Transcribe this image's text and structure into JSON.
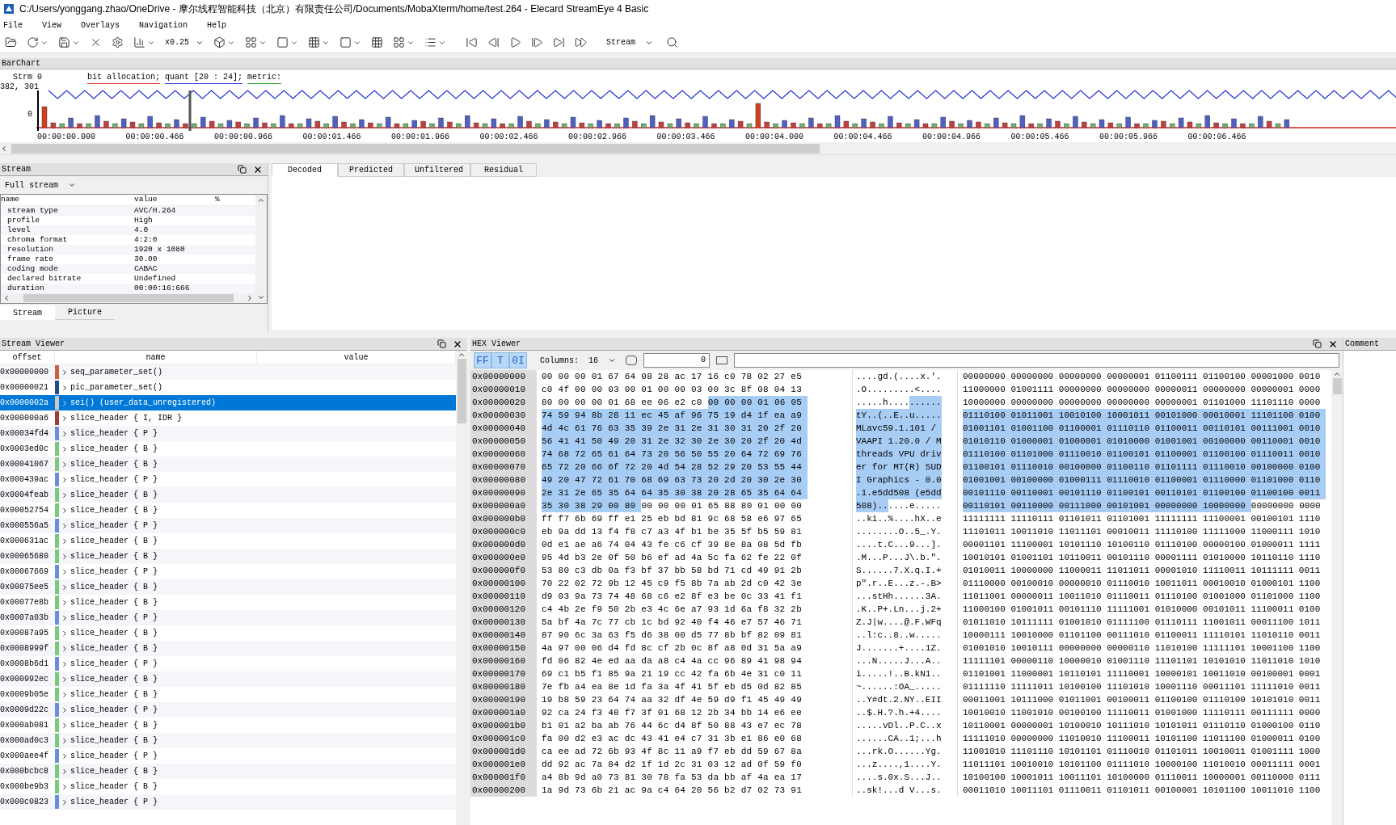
{
  "window": {
    "title": "C:/Users/yonggang.zhao/OneDrive - 摩尔线程智能科技（北京）有限责任公司/Documents/MobaXterm/home/test.264 - Elecard StreamEye 4 Basic"
  },
  "menu": [
    "File",
    "View",
    "Overlays",
    "Navigation",
    "Help"
  ],
  "toolbar": {
    "zoom": "x0.25",
    "stream": "Stream"
  },
  "barchart": {
    "title": "BarChart",
    "legend": [
      {
        "text": "bit allocation;",
        "color": "#e02020"
      },
      {
        "text": "quant [20 : 24];",
        "color": "#2040e0"
      },
      {
        "text": "metric:",
        "color": "#20a020"
      }
    ],
    "stream_label": "Strm 0",
    "y_max": "382, 301",
    "y_min": "0",
    "times": [
      "00:00:00.000",
      "00:00:00.466",
      "00:00:00.966",
      "00:00:01.466",
      "00:00:01.966",
      "00:00:02.466",
      "00:00:02.966",
      "00:00:03.466",
      "00:00:04.000",
      "00:00:04.466",
      "00:00:04.966",
      "00:00:05.466",
      "00:00:05.966",
      "00:00:06.466"
    ]
  },
  "stream_panel": {
    "title": "Stream",
    "filter": "Full stream",
    "columns": [
      "name",
      "value",
      "%"
    ],
    "rows": [
      {
        "name": "stream type",
        "value": "AVC/H.264"
      },
      {
        "name": "profile",
        "value": "High"
      },
      {
        "name": "level",
        "value": "4.0"
      },
      {
        "name": "chroma format",
        "value": "4:2:0"
      },
      {
        "name": "resolution",
        "value": "1920 x 1080"
      },
      {
        "name": "frame rate",
        "value": "30.00"
      },
      {
        "name": "coding mode",
        "value": "CABAC"
      },
      {
        "name": "declared bitrate",
        "value": "Undefined"
      },
      {
        "name": "duration",
        "value": "00:00:16:666"
      }
    ],
    "tabs": [
      {
        "label": "Stream",
        "selected": true
      },
      {
        "label": "Picture",
        "selected": false
      }
    ]
  },
  "picture_tabs": [
    {
      "label": "Decoded",
      "selected": true
    },
    {
      "label": "Predicted",
      "selected": false
    },
    {
      "label": "Unfiltered",
      "selected": false
    },
    {
      "label": "Residual",
      "selected": false
    }
  ],
  "stream_viewer": {
    "title": "Stream Viewer",
    "columns": [
      "offset",
      "name",
      "value"
    ],
    "rows": [
      {
        "offset": "0x00000000",
        "name": "seq_parameter_set()",
        "color": "#c8643c",
        "selected": false
      },
      {
        "offset": "0x00000021",
        "name": "pic_parameter_set()",
        "color": "#1f4e8c",
        "selected": false
      },
      {
        "offset": "0x0000002a",
        "name": "sei() (user_data_unregistered)",
        "color": "#c8c8c8",
        "selected": true
      },
      {
        "offset": "0x000000a6",
        "name": "slice_header { I, IDR }",
        "color": "#a03c32",
        "selected": false
      },
      {
        "offset": "0x00034fd4",
        "name": "slice_header { P }",
        "color": "#6b8ce0",
        "selected": false
      },
      {
        "offset": "0x0003ed0c",
        "name": "slice_header { B }",
        "color": "#7cc87c",
        "selected": false
      },
      {
        "offset": "0x00041067",
        "name": "slice_header { B }",
        "color": "#7cc87c",
        "selected": false
      },
      {
        "offset": "0x000439ac",
        "name": "slice_header { P }",
        "color": "#6b8ce0",
        "selected": false
      },
      {
        "offset": "0x0004feab",
        "name": "slice_header { B }",
        "color": "#7cc87c",
        "selected": false
      },
      {
        "offset": "0x00052754",
        "name": "slice_header { B }",
        "color": "#7cc87c",
        "selected": false
      },
      {
        "offset": "0x000556a5",
        "name": "slice_header { P }",
        "color": "#6b8ce0",
        "selected": false
      },
      {
        "offset": "0x000631ac",
        "name": "slice_header { B }",
        "color": "#7cc87c",
        "selected": false
      },
      {
        "offset": "0x00065680",
        "name": "slice_header { B }",
        "color": "#7cc87c",
        "selected": false
      },
      {
        "offset": "0x00067669",
        "name": "slice_header { P }",
        "color": "#6b8ce0",
        "selected": false
      },
      {
        "offset": "0x00075ee5",
        "name": "slice_header { B }",
        "color": "#7cc87c",
        "selected": false
      },
      {
        "offset": "0x00077e8b",
        "name": "slice_header { B }",
        "color": "#7cc87c",
        "selected": false
      },
      {
        "offset": "0x0007a03b",
        "name": "slice_header { P }",
        "color": "#6b8ce0",
        "selected": false
      },
      {
        "offset": "0x00087a95",
        "name": "slice_header { B }",
        "color": "#7cc87c",
        "selected": false
      },
      {
        "offset": "0x0008999f",
        "name": "slice_header { B }",
        "color": "#7cc87c",
        "selected": false
      },
      {
        "offset": "0x0008b6d1",
        "name": "slice_header { P }",
        "color": "#6b8ce0",
        "selected": false
      },
      {
        "offset": "0x000992ec",
        "name": "slice_header { B }",
        "color": "#7cc87c",
        "selected": false
      },
      {
        "offset": "0x0009b05e",
        "name": "slice_header { B }",
        "color": "#7cc87c",
        "selected": false
      },
      {
        "offset": "0x0009d22c",
        "name": "slice_header { P }",
        "color": "#6b8ce0",
        "selected": false
      },
      {
        "offset": "0x000ab081",
        "name": "slice_header { B }",
        "color": "#7cc87c",
        "selected": false
      },
      {
        "offset": "0x000ad0c3",
        "name": "slice_header { B }",
        "color": "#7cc87c",
        "selected": false
      },
      {
        "offset": "0x000aee4f",
        "name": "slice_header { P }",
        "color": "#6b8ce0",
        "selected": false
      },
      {
        "offset": "0x000bcbc8",
        "name": "slice_header { B }",
        "color": "#7cc87c",
        "selected": false
      },
      {
        "offset": "0x000be9b3",
        "name": "slice_header { B }",
        "color": "#7cc87c",
        "selected": false
      },
      {
        "offset": "0x000c0823",
        "name": "slice_header { P }",
        "color": "#6b8ce0",
        "selected": false
      }
    ]
  },
  "hex_viewer": {
    "title": "HEX Viewer",
    "modes": [
      {
        "label": "FF",
        "selected": true
      },
      {
        "label": "T",
        "selected": true
      },
      {
        "label": "0I",
        "selected": true
      }
    ],
    "columns_label": "Columns:",
    "columns_value": "16",
    "offset_value": "0",
    "rows": [
      {
        "offset": "0x00000000",
        "hex": [
          {
            "text": "00 00 00 01 67 64 08 28 ac 17 16 c0 78 02 27 e5",
            "selected": false
          }
        ],
        "ascii": [
          {
            "text": "....gd.(....x.'.",
            "selected": false
          }
        ],
        "bits": [
          {
            "text": "00000000 00000000 00000000 00000001 01100111 01100100 00001000 0010",
            "selected": false
          }
        ]
      },
      {
        "offset": "0x00000010",
        "hex": [
          {
            "text": "c0 4f 00 00 03 00 01 00 00 03 00 3c 8f 08 04 13",
            "selected": false
          }
        ],
        "ascii": [
          {
            "text": ".O.........<....",
            "selected": false
          }
        ],
        "bits": [
          {
            "text": "11000000 01001111 00000000 00000000 00000011 00000000 00000001 0000",
            "selected": false
          }
        ]
      },
      {
        "offset": "0x00000020",
        "hex": [
          {
            "text": "80 00 00 00 01 68 ee 06 e2 c0",
            "selected": false
          },
          {
            "text": "00 00 00 01 06 05",
            "selected": true
          }
        ],
        "ascii": [
          {
            "text": ".....h....",
            "selected": false
          },
          {
            "text": "......",
            "selected": true
          }
        ],
        "bits": [
          {
            "text": "10000000 00000000 00000000 00000000 00000001 01101000 11101110 0000",
            "selected": false
          }
        ]
      },
      {
        "offset": "0x00000030",
        "hex": [
          {
            "text": "74 59 94 8b 28 11 ec 45 af 96 75 19 d4 1f ea a9",
            "selected": true
          }
        ],
        "ascii": [
          {
            "text": "tY..(..E..u.....",
            "selected": true
          }
        ],
        "bits": [
          {
            "text": "01110100 01011001 10010100 10001011 00101000 00010001 11101100 0100",
            "selected": true
          }
        ]
      },
      {
        "offset": "0x00000040",
        "hex": [
          {
            "text": "4d 4c 61 76 63 35 39 2e 31 2e 31 30 31 20 2f 20",
            "selected": true
          }
        ],
        "ascii": [
          {
            "text": "MLavc59.1.101 / ",
            "selected": true
          }
        ],
        "bits": [
          {
            "text": "01001101 01001100 01100001 01110110 01100011 00110101 00111001 0010",
            "selected": true
          }
        ]
      },
      {
        "offset": "0x00000050",
        "hex": [
          {
            "text": "56 41 41 50 49 20 31 2e 32 30 2e 30 20 2f 20 4d",
            "selected": true
          }
        ],
        "ascii": [
          {
            "text": "VAAPI 1.20.0 / M",
            "selected": true
          }
        ],
        "bits": [
          {
            "text": "01010110 01000001 01000001 01010000 01001001 00100000 00110001 0010",
            "selected": true
          }
        ]
      },
      {
        "offset": "0x00000060",
        "hex": [
          {
            "text": "74 68 72 65 61 64 73 20 56 50 55 20 64 72 69 76",
            "selected": true
          }
        ],
        "ascii": [
          {
            "text": "threads VPU driv",
            "selected": true
          }
        ],
        "bits": [
          {
            "text": "01110100 01101000 01110010 01100101 01100001 01100100 01110011 0010",
            "selected": true
          }
        ]
      },
      {
        "offset": "0x00000070",
        "hex": [
          {
            "text": "65 72 20 66 6f 72 20 4d 54 28 52 29 20 53 55 44",
            "selected": true
          }
        ],
        "ascii": [
          {
            "text": "er for MT(R) SUD",
            "selected": true
          }
        ],
        "bits": [
          {
            "text": "01100101 01110010 00100000 01100110 01101111 01110010 00100000 0100",
            "selected": true
          }
        ]
      },
      {
        "offset": "0x00000080",
        "hex": [
          {
            "text": "49 20 47 72 61 70 68 69 63 73 20 2d 20 30 2e 30",
            "selected": true
          }
        ],
        "ascii": [
          {
            "text": "I Graphics - 0.0",
            "selected": true
          }
        ],
        "bits": [
          {
            "text": "01001001 00100000 01000111 01110010 01100001 01110000 01101000 0110",
            "selected": true
          }
        ]
      },
      {
        "offset": "0x00000090",
        "hex": [
          {
            "text": "2e 31 2e 65 35 64 64 35 30 38 20 28 65 35 64 64",
            "selected": true
          }
        ],
        "ascii": [
          {
            "text": ".1.e5dd508 (e5dd",
            "selected": true
          }
        ],
        "bits": [
          {
            "text": "00101110 00110001 00101110 01100101 00110101 01100100 01100100 0011",
            "selected": true
          }
        ]
      },
      {
        "offset": "0x000000a0",
        "hex": [
          {
            "text": "35 30 38 29 00 80",
            "selected": true
          },
          {
            "text": "00 00 00 01 65 88 80 01 00 00",
            "selected": false
          }
        ],
        "ascii": [
          {
            "text": "508)..",
            "selected": true
          },
          {
            "text": "....e.....",
            "selected": false
          }
        ],
        "bits": [
          {
            "text": "00110101 00110000 00111000 00101001 00000000 10000000",
            "selected": true
          },
          {
            "text": "00000000 0000",
            "selected": false
          }
        ]
      },
      {
        "offset": "0x000000b0",
        "hex": [
          {
            "text": "ff f7 6b 69 ff e1 25 eb bd 81 9c 68 58 e6 97 65",
            "selected": false
          }
        ],
        "ascii": [
          {
            "text": "..ki..%....hX..e",
            "selected": false
          }
        ],
        "bits": [
          {
            "text": "11111111 11110111 01101011 01101001 11111111 11100001 00100101 1110",
            "selected": false
          }
        ]
      },
      {
        "offset": "0x000000c0",
        "hex": [
          {
            "text": "eb 9a dd 13 f4 f8 c7 a3 4f b1 be 35 5f b5 59 81",
            "selected": false
          }
        ],
        "ascii": [
          {
            "text": "........O..5_.Y.",
            "selected": false
          }
        ],
        "bits": [
          {
            "text": "11101011 10011010 11011101 00010011 11110100 11111000 11000111 1010",
            "selected": false
          }
        ]
      },
      {
        "offset": "0x000000d0",
        "hex": [
          {
            "text": "0d e1 ae a6 74 04 43 fe c6 cf 39 8e 8a 08 5d fb",
            "selected": false
          }
        ],
        "ascii": [
          {
            "text": "....t.C...9...].",
            "selected": false
          }
        ],
        "bits": [
          {
            "text": "00001101 11100001 10101110 10100110 01110100 00000100 01000011 1111",
            "selected": false
          }
        ]
      },
      {
        "offset": "0x000000e0",
        "hex": [
          {
            "text": "95 4d b3 2e 0f 50 b6 ef ad 4a 5c fa 62 fe 22 0f",
            "selected": false
          }
        ],
        "ascii": [
          {
            "text": ".M...P...J\\.b.\".",
            "selected": false
          }
        ],
        "bits": [
          {
            "text": "10010101 01001101 10110011 00101110 00001111 01010000 10110110 1110",
            "selected": false
          }
        ]
      },
      {
        "offset": "0x000000f0",
        "hex": [
          {
            "text": "53 80 c3 db 0a f3 bf 37 bb 58 bd 71 cd 49 91 2b",
            "selected": false
          }
        ],
        "ascii": [
          {
            "text": "S......7.X.q.I.+",
            "selected": false
          }
        ],
        "bits": [
          {
            "text": "01010011 10000000 11000011 11011011 00001010 11110011 10111111 0011",
            "selected": false
          }
        ]
      },
      {
        "offset": "0x00000100",
        "hex": [
          {
            "text": "70 22 02 72 9b 12 45 c9 f5 8b 7a ab 2d c0 42 3e",
            "selected": false
          }
        ],
        "ascii": [
          {
            "text": "p\".r..E...z.-.B>",
            "selected": false
          }
        ],
        "bits": [
          {
            "text": "01110000 00100010 00000010 01110010 10011011 00010010 01000101 1100",
            "selected": false
          }
        ]
      },
      {
        "offset": "0x00000110",
        "hex": [
          {
            "text": "d9 03 9a 73 74 48 68 c6 e2 8f e3 be 0c 33 41 f1",
            "selected": false
          }
        ],
        "ascii": [
          {
            "text": "...stHh......3A.",
            "selected": false
          }
        ],
        "bits": [
          {
            "text": "11011001 00000011 10011010 01110011 01110100 01001000 01101000 1100",
            "selected": false
          }
        ]
      },
      {
        "offset": "0x00000120",
        "hex": [
          {
            "text": "c4 4b 2e f9 50 2b e3 4c 6e a7 93 1d 6a f8 32 2b",
            "selected": false
          }
        ],
        "ascii": [
          {
            "text": ".K..P+.Ln...j.2+",
            "selected": false
          }
        ],
        "bits": [
          {
            "text": "11000100 01001011 00101110 11111001 01010000 00101011 11100011 0100",
            "selected": false
          }
        ]
      },
      {
        "offset": "0x00000130",
        "hex": [
          {
            "text": "5a bf 4a 7c 77 cb 1c bd 92 40 f4 46 e7 57 46 71",
            "selected": false
          }
        ],
        "ascii": [
          {
            "text": "Z.J|w....@.F.WFq",
            "selected": false
          }
        ],
        "bits": [
          {
            "text": "01011010 10111111 01001010 01111100 01110111 11001011 00011100 1011",
            "selected": false
          }
        ]
      },
      {
        "offset": "0x00000140",
        "hex": [
          {
            "text": "87 90 6c 3a 63 f5 d6 38 00 d5 77 8b bf 82 09 81",
            "selected": false
          }
        ],
        "ascii": [
          {
            "text": "..l:c..8..w.....",
            "selected": false
          }
        ],
        "bits": [
          {
            "text": "10000111 10010000 01101100 00111010 01100011 11110101 11010110 0011",
            "selected": false
          }
        ]
      },
      {
        "offset": "0x00000150",
        "hex": [
          {
            "text": "4a 97 00 06 d4 fd 8c cf 2b 0c 8f a8 0d 31 5a a9",
            "selected": false
          }
        ],
        "ascii": [
          {
            "text": "J.......+....1Z.",
            "selected": false
          }
        ],
        "bits": [
          {
            "text": "01001010 10010111 00000000 00000110 11010100 11111101 10001100 1100",
            "selected": false
          }
        ]
      },
      {
        "offset": "0x00000160",
        "hex": [
          {
            "text": "fd 06 82 4e ed aa da a8 c4 4a cc 96 89 41 98 94",
            "selected": false
          }
        ],
        "ascii": [
          {
            "text": "...N.....J...A..",
            "selected": false
          }
        ],
        "bits": [
          {
            "text": "11111101 00000110 10000010 01001110 11101101 10101010 11011010 1010",
            "selected": false
          }
        ]
      },
      {
        "offset": "0x00000170",
        "hex": [
          {
            "text": "69 c1 b5 f1 85 9a 21 19 cc 42 fa 6b 4e 31 c0 11",
            "selected": false
          }
        ],
        "ascii": [
          {
            "text": "i.....!..B.kN1..",
            "selected": false
          }
        ],
        "bits": [
          {
            "text": "01101001 11000001 10110101 11110001 10000101 10011010 00100001 0001",
            "selected": false
          }
        ]
      },
      {
        "offset": "0x00000180",
        "hex": [
          {
            "text": "7e fb a4 ea 8e 1d fa 3a 4f 41 5f eb d5 0d 82 85",
            "selected": false
          }
        ],
        "ascii": [
          {
            "text": "~......:OA_.....",
            "selected": false
          }
        ],
        "bits": [
          {
            "text": "01111110 11111011 10100100 11101010 10001110 00011101 11111010 0011",
            "selected": false
          }
        ]
      },
      {
        "offset": "0x00000190",
        "hex": [
          {
            "text": "19 b8 59 23 64 74 aa 32 df 4e 59 d9 f1 45 49 49",
            "selected": false
          }
        ],
        "ascii": [
          {
            "text": "..Y#dt.2.NY..EII",
            "selected": false
          }
        ],
        "bits": [
          {
            "text": "00011001 10111000 01011001 00100011 01100100 01110100 10101010 0011",
            "selected": false
          }
        ]
      },
      {
        "offset": "0x000001a0",
        "hex": [
          {
            "text": "92 ca 24 f3 48 f7 3f 01 68 12 2b 34 bb 14 e6 ee",
            "selected": false
          }
        ],
        "ascii": [
          {
            "text": "..$.H.?.h.+4....",
            "selected": false
          }
        ],
        "bits": [
          {
            "text": "10010010 11001010 00100100 11110011 01001000 11110111 00111111 0000",
            "selected": false
          }
        ]
      },
      {
        "offset": "0x000001b0",
        "hex": [
          {
            "text": "b1 01 a2 ba ab 76 44 6c d4 8f 50 88 43 e7 ec 78",
            "selected": false
          }
        ],
        "ascii": [
          {
            "text": ".....vDl..P.C..x",
            "selected": false
          }
        ],
        "bits": [
          {
            "text": "10110001 00000001 10100010 10111010 10101011 01110110 01000100 0110",
            "selected": false
          }
        ]
      },
      {
        "offset": "0x000001c0",
        "hex": [
          {
            "text": "fa 00 d2 e3 ac dc 43 41 e4 c7 31 3b e1 86 e0 68",
            "selected": false
          }
        ],
        "ascii": [
          {
            "text": "......CA..1;...h",
            "selected": false
          }
        ],
        "bits": [
          {
            "text": "11111010 00000000 11010010 11100011 10101100 11011100 01000011 0100",
            "selected": false
          }
        ]
      },
      {
        "offset": "0x000001d0",
        "hex": [
          {
            "text": "ca ee ad 72 6b 93 4f 8c 11 a9 f7 eb dd 59 67 8a",
            "selected": false
          }
        ],
        "ascii": [
          {
            "text": "...rk.O......Yg.",
            "selected": false
          }
        ],
        "bits": [
          {
            "text": "11001010 11101110 10101101 01110010 01101011 10010011 01001111 1000",
            "selected": false
          }
        ]
      },
      {
        "offset": "0x000001e0",
        "hex": [
          {
            "text": "dd 92 ac 7a 84 d2 1f 1d 2c 31 03 12 ad 0f 59 f0",
            "selected": false
          }
        ],
        "ascii": [
          {
            "text": "...z....,1....Y.",
            "selected": false
          }
        ],
        "bits": [
          {
            "text": "11011101 10010010 10101100 01111010 10000100 11010010 00011111 0001",
            "selected": false
          }
        ]
      },
      {
        "offset": "0x000001f0",
        "hex": [
          {
            "text": "a4 8b 9d a0 73 81 30 78 fa 53 da bb af 4a ea 17",
            "selected": false
          }
        ],
        "ascii": [
          {
            "text": "....s.0x.S...J..",
            "selected": false
          }
        ],
        "bits": [
          {
            "text": "10100100 10001011 10011101 10100000 01110011 10000001 00110000 0111",
            "selected": false
          }
        ]
      },
      {
        "offset": "0x00000200",
        "hex": [
          {
            "text": "1a 9d 73 6b 21 ac 9a c4 64 20 56 b2 d7 02 73 91",
            "selected": false
          }
        ],
        "ascii": [
          {
            "text": "..sk!...d V...s.",
            "selected": false
          }
        ],
        "bits": [
          {
            "text": "00011010 10011101 01110011 01101011 00100001 10101100 10011010 1100",
            "selected": false
          }
        ]
      }
    ]
  },
  "comment_panel": {
    "title": "Comment"
  }
}
